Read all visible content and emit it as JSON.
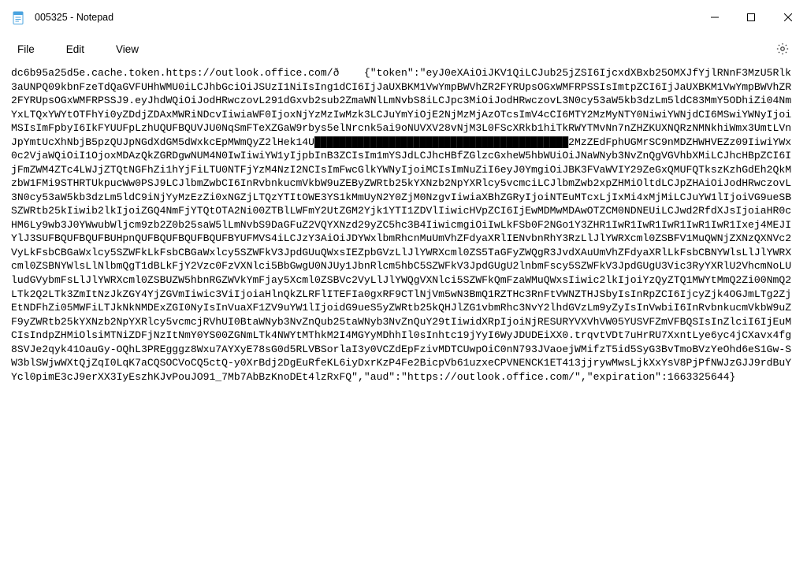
{
  "titlebar": {
    "title": "005325 - Notepad"
  },
  "menubar": {
    "file": "File",
    "edit": "Edit",
    "view": "View"
  },
  "document": {
    "text": "dc6b95a25d5e.cache.token.https://outlook.office.com/ð{\"token\":\"eyJ0eXAiOiJKV1QiLCJub25jZSI6IjcxdXBxb25OMXJfYjlRNnF3MzU5Rlk3aUNPQ09kbnFzeTdQaGVFUHhWMU0iLCJhbGciOiJSUzI1NiIsIng1dCI6IjJaUXBKM1VwYmpBWVhZR2FYRUpsOGxWMFRPSSIsImtpZCI6IjJaUXBKM1VwYmpBWVhZR2FYRUpsOGxWMFRPSSJ9.eyJhdWQiOiJodHRwczovL291dGxvb2sub2ZmaWNlLmNvbS8iLCJpc3MiOiJodHRwczovL3N0cy53aW5kb3dzLm5ldC83MmY5ODhiZi04NmYxLTQxYWYtOTFhYi0yZDdjZDAxMWRiNDcvIiwiaWF0IjoxNjYzMzIwMzk3LCJuYmYiOjE2NjMzMjAzOTcsImV4cCI6MTY2MzMyNTY0NiwiYWNjdCI6MSwiYWNyIjoiMSIsImFpbyI6IkFYUUFpLzhUQUFBQUVJU0NqSmFTeXZGaW9rbys5elNrcnk5ai9oNUVXV28vNjM3L0FScXRkb1hiTkRWYTMvNn7nZHZKUXNQRzNMNkhiWmx3UmtLVnJpYmtUcXhNbjB5pzQUJpNGdXdGM5dWxkcEpMWmQyZ2lHek14U█████████████████████████████████████████2MzZEdFphUGMrSC9nMDZHWHVEZz09IiwiYWx0c2VjaWQiOiI1OjoxMDAzQkZGRDgwNUM4N0IwIiwiYW1yIjpbInB3ZCIsIm1mYSJdLCJhcHBfZGlzcGxheW5hbWUiOiJNaWNyb3NvZnQgVGVhbXMiLCJhcHBpZCI6IjFmZWM4ZTc4LWJjZTQtNGFhZi1hYjFiLTU0NTFjYzM4NzI2NCIsImFwcGlkYWNyIjoiMCIsImNuZiI6eyJ0YmgiOiJBK3FVaWVIY29ZeGxQMUFQTkszKzhGdEh2QkMzbW1FMi9STHRTUkpucWw0PSJ9LCJlbmZwbCI6InRvbnkucmVkbW9uZEByZWRtb25kYXNzb2NpYXRlcy5vcmciLCJlbmZwb2xpZHMiOltdLCJpZHAiOiJodHRwczovL3N0cy53aW5kb3dzLm5ldC9iNjYyMzEzZi0xNGZjLTQzYTItOWE3YS1kMmUyN2Y0ZjM0NzgvIiwiaXBhZGRyIjoiNTEuMTcxLjIxMi4xMjMiLCJuYW1lIjoiVG9ueSBSZWRtb25kIiwib2lkIjoiZGQ4NmFjYTQtOTA2Ni00ZTBlLWFmY2UtZGM2Yjk1YTI1ZDVlIiwicHVpZCI6IjEwMDMwMDAwOTZCM0NDNEUiLCJwd2RfdXJsIjoiaHR0cHM6Ly9wb3J0YWwubWljcm9zb2Z0b25saW5lLmNvbS9DaGFuZ2VQYXNzd29yZC5hc3B4IiwicmgiOiIwLkFSb0F2NGo1Y3ZHR1IwR1IwR1IwR1IwR1IwR1Ixej4MEJIYlJ3SUFBQUFBQUFBUHpnQUFBQUFBQUFBQUFBYUFMVS4iLCJzY3AiOiJDYWxlbmRhcnMuUmVhZFdyaXRlIENvbnRhY3RzLlJlYWRXcml0ZSBFV1MuQWNjZXNzQXNVc2VyLkFsbCBGaWxlcy5SZWFkLkFsbCBGaWxlcy5SZWFkV3JpdGUuQWxsIEZpbGVzLlJlYWRXcml0ZS5TaGFyZWQgR3JvdXAuUmVhZFdyaXRlLkFsbCBNYWlsLlJlYWRXcml0ZSBNYWlsLlNlbmQgT1dBLkFjY2Vzc0FzVXNlci5BbGwgU0NJUy1JbnRlcm5hbC5SZWFkV3JpdGUgU2lnbmFscy5SZWFkV3JpdGUgU3Vic3RyYXRlU2VhcmNoLUludGVybmFsLlJlYWRXcml0ZSBUZW5hbnRGZWVkYmFjay5Xcml0ZSBVc2VyLlJlYWQgVXNlci5SZWFkQmFzaWMuQWxsIiwic2lkIjoiYzQyZTQ1MWYtMmQ2Zi00NmQ2LTk2Q2LTk3ZmItNzJkZGY4YjZGVmIiwic3ViIjoiaHlnQkZLRFlITEFIa0gxRF9CTlNjVm5wN3BmQ1RZTHc3RnFtVWNZTHJSbyIsInRpZCI6IjcyZjk4OGJmLTg2ZjEtNDFhZi05MWFiLTJkNkNMDExZGI0NyIsInVuaXF1ZV9uYW1lIjoidG9ueS5yZWRtb25kQHJlZG1vbmRhc3NvY2lhdGVzLm9yZyIsInVwbiI6InRvbnkucmVkbW9uZF9yZWRtb25kYXNzb2NpYXRlcy5vcmcjRVhUI0BtaWNyb3NvZnQub25taWNyb3NvZnQuY29tIiwidXRpIjoiNjRESURYVXVhVW05YUSVFZmVFBQSIsInZlciI6IjEuMCIsIndpZHMiOlsiMTNiZDFjNzItNmY0YS00ZGNmLTk4NWYtMThkM2I4MGYyMDhhIl0sInhtc19jYyI6WyJDUDEiXX0.trqvtVDt7uHrRU7XxntLye6yc4jCXavx4fg8SVJe2qyk41OauGy-OQhL3PREgggz8Wxu7AYXyE78sG0d5RLVBSorlaI3y0VCZdEpFzivMDTCUwpOiC0nN793JVaoejWMifzT5id5SyG3BvTmoBVzYeOhd6eS1Gw-SW3blSWjwWXtQjZqI0LqK7aCQSOCVoCQ5ctQ-y0XrBdj2DgEuRfeKL6iyDxrKzP4Fe2BicpVb61uzxeCPVNENCK1ET413jjrywMwsLjkXxYsV8PjPfNWJzGJJ9rdBuYYcl0pimE3cJ9erXX3IyEszhKJvPouJO91_7Mb7AbBzKnoDEt4lzRxFQ\",\"aud\":\"https://outlook.office.com/\",\"expiration\":1663325644}"
  }
}
